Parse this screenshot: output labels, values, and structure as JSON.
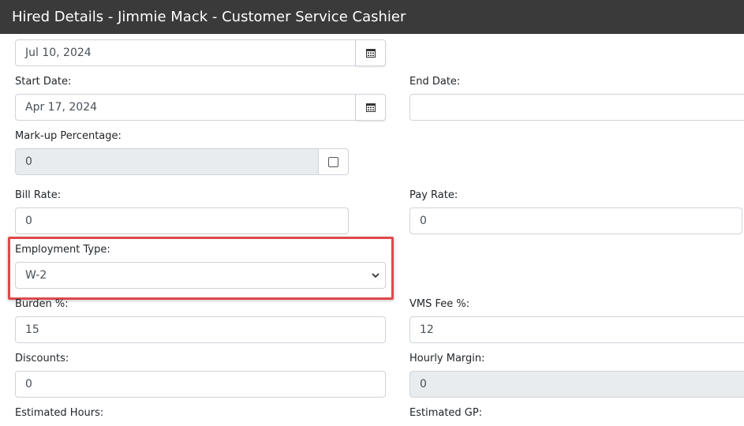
{
  "header": {
    "title": "Hired Details - Jimmie Mack - Customer Service Cashier"
  },
  "fields": {
    "hire_date": {
      "value": "Jul 10, 2024"
    },
    "start_date": {
      "label": "Start Date:",
      "value": "Apr 17, 2024"
    },
    "end_date": {
      "label": "End Date:",
      "value": ""
    },
    "markup_percentage": {
      "label": "Mark-up Percentage:",
      "value": "0",
      "checked": false
    },
    "bill_rate": {
      "label": "Bill Rate:",
      "value": "0"
    },
    "pay_rate": {
      "label": "Pay Rate:",
      "value": "0"
    },
    "employment_type": {
      "label": "Employment Type:",
      "selected": "W-2"
    },
    "burden": {
      "label": "Burden %:",
      "value": "15"
    },
    "vms_fee": {
      "label": "VMS Fee %:",
      "value": "12"
    },
    "discounts": {
      "label": "Discounts:",
      "value": "0"
    },
    "hourly_margin": {
      "label": "Hourly Margin:",
      "value": "0"
    },
    "estimated_hours": {
      "label": "Estimated Hours:"
    },
    "estimated_gp": {
      "label": "Estimated GP:"
    }
  },
  "icons": {
    "calendar": "calendar-icon",
    "chevron": "chevron-down-icon"
  },
  "colors": {
    "header_bg": "#3a3a3a",
    "highlight": "#e0484d",
    "disabled_bg": "#e9ecef"
  }
}
